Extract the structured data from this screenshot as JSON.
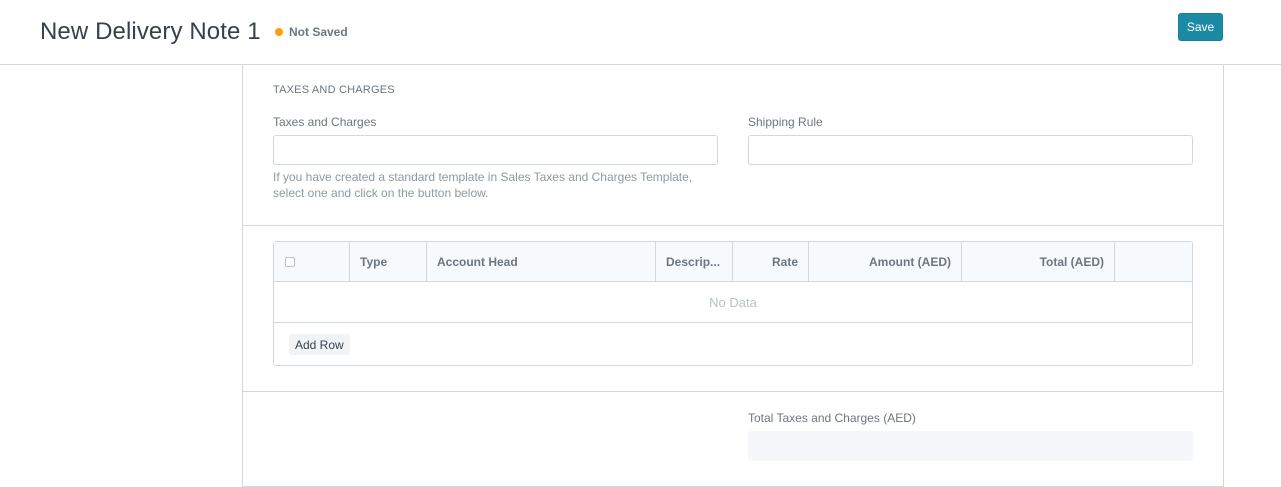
{
  "header": {
    "title": "New Delivery Note 1",
    "status": "Not Saved",
    "status_color": "#ffa00a",
    "save_label": "Save",
    "accent": "#1d8aa4"
  },
  "taxes_section": {
    "title": "TAXES AND CHARGES",
    "taxes_label": "Taxes and Charges",
    "taxes_value": "",
    "shipping_label": "Shipping Rule",
    "shipping_value": "",
    "help_text": "If you have created a standard template in Sales Taxes and Charges Template, select one and click on the button below."
  },
  "grid": {
    "columns": [
      "Type",
      "Account Head",
      "Descrip...",
      "Rate",
      "Amount (AED)",
      "Total (AED)"
    ],
    "rows": [],
    "empty_text": "No Data",
    "add_row_label": "Add Row"
  },
  "totals": {
    "label": "Total Taxes and Charges (AED)",
    "value": ""
  }
}
